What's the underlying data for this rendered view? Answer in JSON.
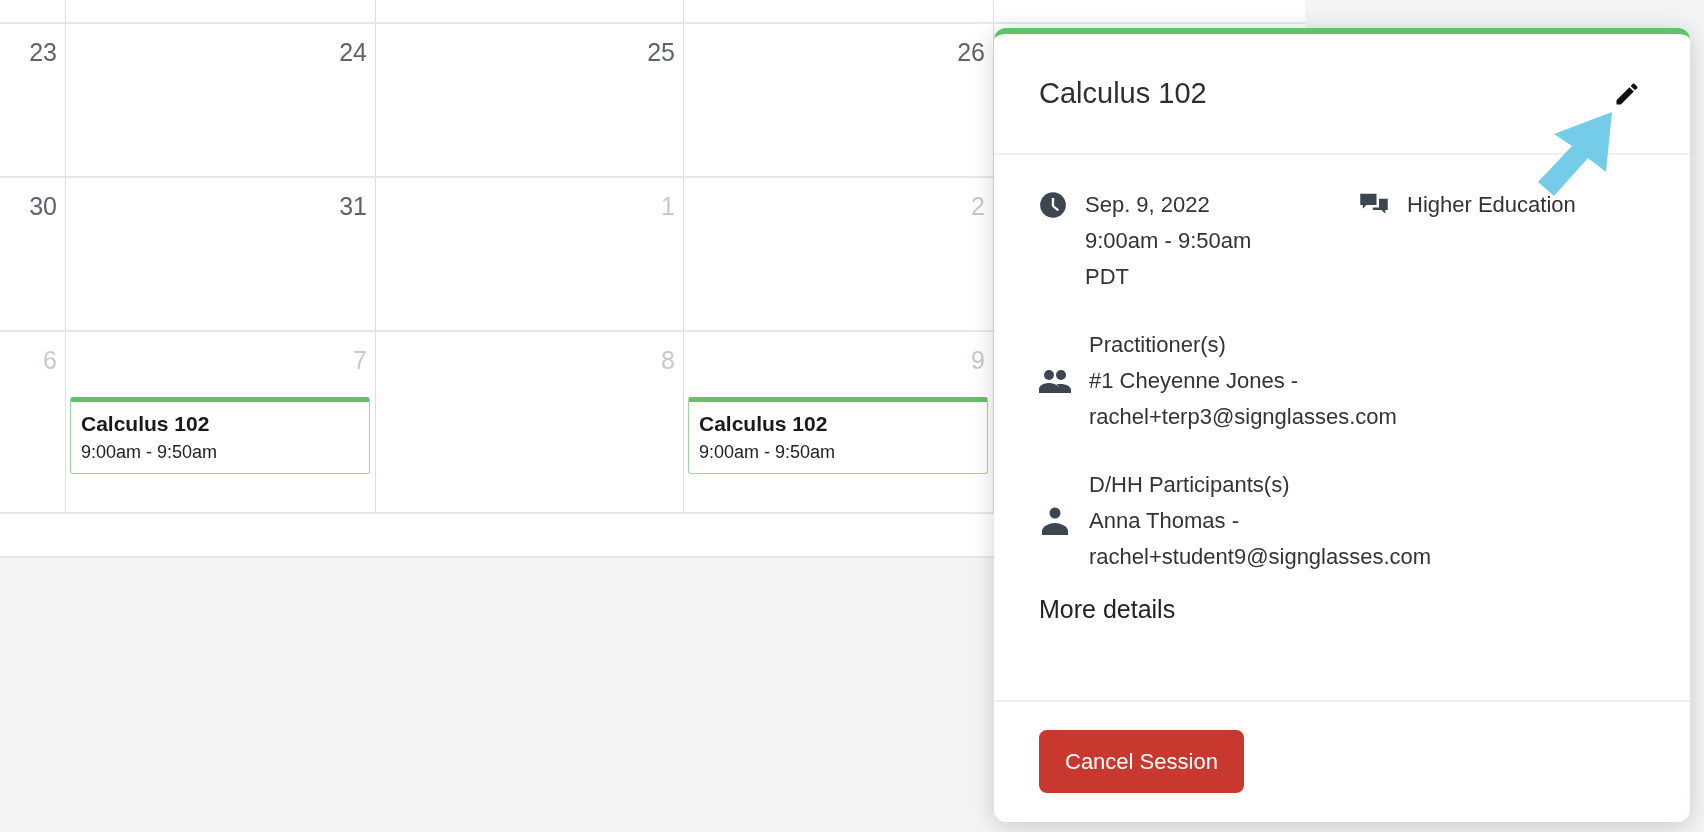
{
  "calendar": {
    "weeks": [
      {
        "days": [
          {
            "number": "23",
            "muted": false
          },
          {
            "number": "24",
            "muted": false
          },
          {
            "number": "25",
            "muted": false
          },
          {
            "number": "26",
            "muted": false
          }
        ]
      },
      {
        "days": [
          {
            "number": "30",
            "muted": false
          },
          {
            "number": "31",
            "muted": false
          },
          {
            "number": "1",
            "muted": true
          },
          {
            "number": "2",
            "muted": true
          }
        ]
      },
      {
        "days": [
          {
            "number": "6",
            "muted": true
          },
          {
            "number": "7",
            "muted": true,
            "events": [
              {
                "title": "Calculus 102",
                "time": "9:00am - 9:50am"
              }
            ]
          },
          {
            "number": "8",
            "muted": true
          },
          {
            "number": "9",
            "muted": true,
            "events": [
              {
                "title": "Calculus 102",
                "time": "9:00am - 9:50am"
              }
            ]
          }
        ]
      }
    ]
  },
  "popover": {
    "title": "Calculus 102",
    "date": "Sep. 9, 2022",
    "time": "9:00am - 9:50am",
    "timezone": "PDT",
    "category": "Higher Education",
    "sections": [
      {
        "kind": "group",
        "label": "Practitioner(s)",
        "lines": [
          "#1 Cheyenne Jones -",
          "rachel+terp3@signglasses.com"
        ]
      },
      {
        "kind": "person",
        "label": "D/HH Participants(s)",
        "lines": [
          "Anna Thomas -",
          "rachel+student9@signglasses.com"
        ]
      }
    ],
    "more_link": "More details",
    "cancel_button": "Cancel Session"
  }
}
